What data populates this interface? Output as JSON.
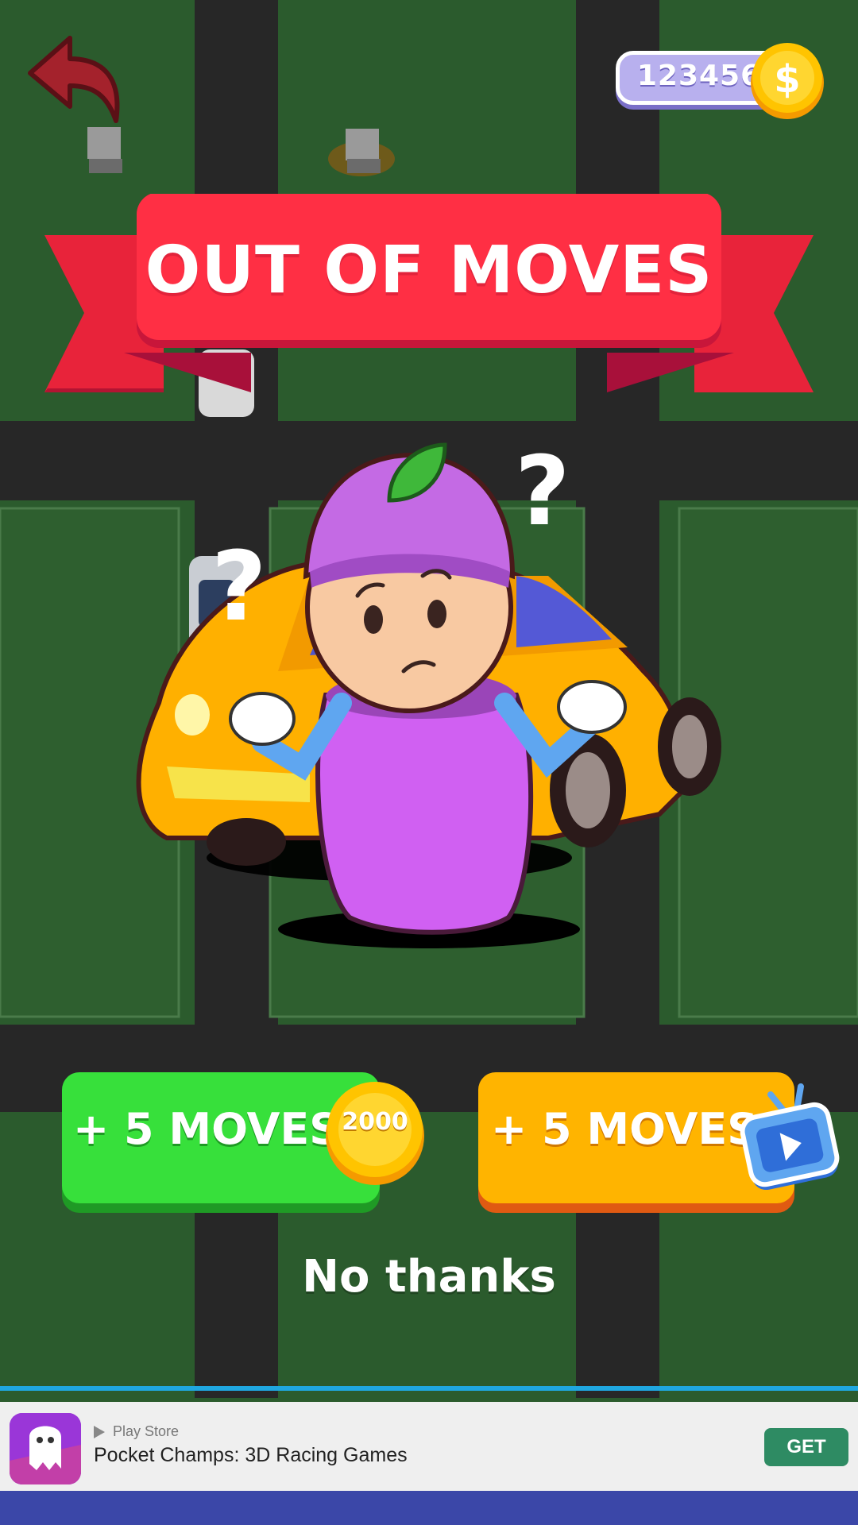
{
  "header": {
    "back_icon": "back-arrow-icon",
    "coins": "123456",
    "coin_icon": "dollar-coin-icon"
  },
  "dialog": {
    "title": "OUT OF MOVES",
    "illustration": "confused-eggplant-character-with-car",
    "question_marks": [
      "?",
      "?"
    ]
  },
  "actions": {
    "coin_option": {
      "label": "+ 5 MOVES",
      "price": "2000",
      "icon": "coin-icon",
      "color": "#37e03b"
    },
    "ad_option": {
      "label": "+ 5 MOVES",
      "icon": "tv-play-icon",
      "color": "#ffb400"
    },
    "decline": "No thanks"
  },
  "ad_banner": {
    "store": "Play Store",
    "app_title": "Pocket Champs: 3D Racing Games",
    "cta": "GET",
    "app_icon": "ghost-racer-app-icon"
  },
  "colors": {
    "grass": "#2a5a2c",
    "road": "#272727",
    "ribbon": "#ff2f44",
    "ribbon_dark": "#c8163a"
  }
}
